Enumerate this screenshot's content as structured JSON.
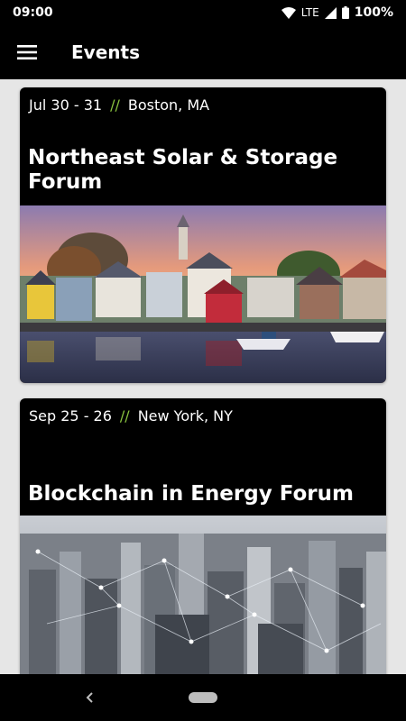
{
  "status_bar": {
    "time": "09:00",
    "network": "LTE",
    "battery": "100%"
  },
  "app_bar": {
    "title": "Events",
    "menu_icon": "hamburger-menu-icon"
  },
  "events": [
    {
      "dates": "Jul 30 - 31",
      "separator": "//",
      "location": "Boston, MA",
      "title": "Northeast Solar & Storage Forum",
      "image": "harbor-town-sunset-photo"
    },
    {
      "dates": "Sep 25 - 26",
      "separator": "//",
      "location": "New York, NY",
      "title": "Blockchain in Energy Forum",
      "image": "city-aerial-network-photo"
    }
  ],
  "nav_bar": {
    "back_icon": "back-chevron-icon",
    "home_icon": "home-pill-icon"
  },
  "colors": {
    "accent": "#8ac43f",
    "card_bg": "#000000",
    "page_bg": "#e6e6e6"
  }
}
